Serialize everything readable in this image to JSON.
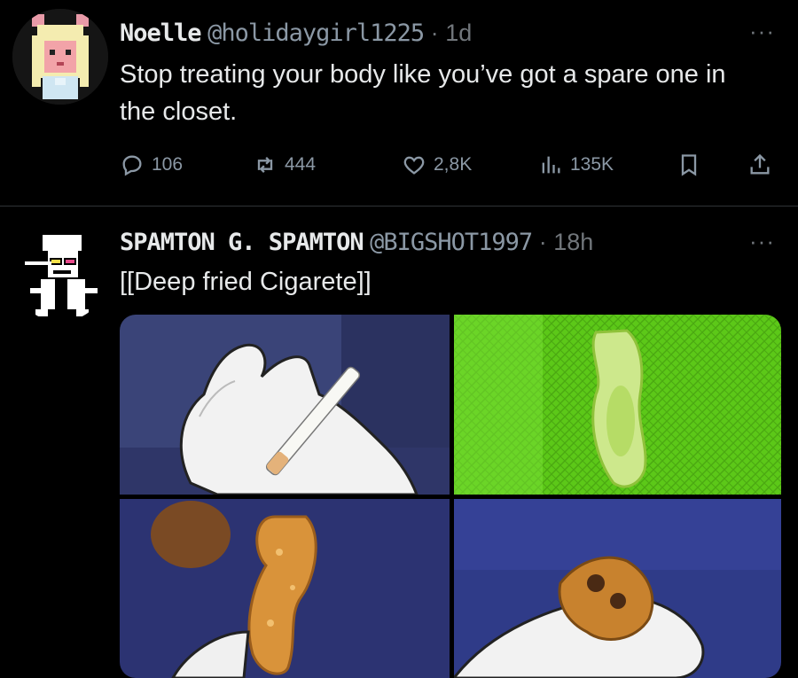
{
  "tweet1": {
    "name": "Noelle",
    "handle": "@holidaygirl1225",
    "separator": "·",
    "time": "1d",
    "more": "···",
    "text": "Stop treating your body like you’ve got a spare one in the closet.",
    "actions": {
      "replies": "106",
      "reposts": "444",
      "likes": "2,8K",
      "views": "135K"
    }
  },
  "tweet2": {
    "name": "SPAMTON G. SPAMTON",
    "handle": "@BIGSHOT1997",
    "separator": "·",
    "time": "18h",
    "more": "···",
    "text": "[[Deep fried Cigarete]]"
  },
  "colors": {
    "background": "#000000",
    "text": "#e7e9ea",
    "muted": "#71767b",
    "divider": "#2f3336",
    "green_tile": "#6fdc1a",
    "blue_tile": "#2a2f6e"
  }
}
